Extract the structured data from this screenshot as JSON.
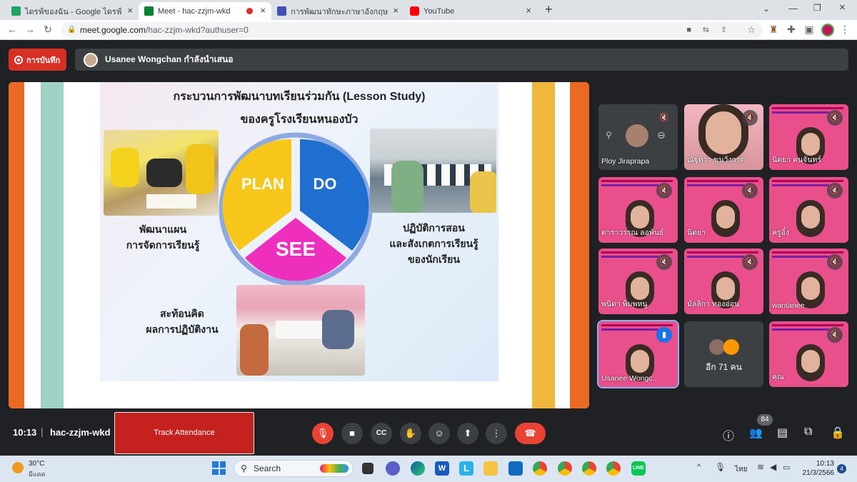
{
  "browser": {
    "tabs": [
      {
        "title": "ไดรฟ์ของฉัน - Google ไดรฟ์",
        "color": "#1fa463"
      },
      {
        "title": "Meet - hac-zzjm-wkd",
        "color": "#00832d",
        "active": true
      },
      {
        "title": "การพัฒนาทักษะภาษาอังกฤษ English",
        "color": "#3f51b5"
      },
      {
        "title": "YouTube",
        "color": "#ff0000"
      }
    ],
    "new_tab": "+",
    "url_host": "meet.google.com",
    "url_path": "/hac-zzjm-wkd?authuser=0"
  },
  "meet": {
    "record_label": "การบันทึก",
    "presenter_text": "Usanee Wongchan กำลังนำเสนอ",
    "slide": {
      "title1": "กระบวนการพัฒนาบทเรียนร่วมกัน (Lesson Study)",
      "title2": "ของครูโรงเรียนหนองบัว",
      "cycle": {
        "plan": "PLAN",
        "do": "DO",
        "see": "SEE"
      },
      "left_caption": [
        "พัฒนาแผน",
        "การจัดการเรียนรู้"
      ],
      "right_caption": [
        "ปฏิบัติการสอน",
        "และสังเกตการเรียนรู้",
        "ของนักเรียน"
      ],
      "bottom_caption": [
        "สะท้อนคิด",
        "ผลการปฏิบัติงาน"
      ]
    },
    "participants": [
      {
        "name": "Ploy Jiraprapa",
        "style": "gray"
      },
      {
        "name": "ณัฐทิวา ขุนวังกรด",
        "style": "face"
      },
      {
        "name": "นิตยา คนจันทร์",
        "style": "slide"
      },
      {
        "name": "ดาราวรรณ ลอพันธ์",
        "style": "slide"
      },
      {
        "name": "นิตยา",
        "style": "slide-face"
      },
      {
        "name": "ครูอิ๋ง",
        "style": "slide"
      },
      {
        "name": "พนิดา พิมพหนู",
        "style": "slide-face"
      },
      {
        "name": "มัลลิกา ทองอ่อน",
        "style": "slide-face"
      },
      {
        "name": "wantanee",
        "style": "slide-face"
      },
      {
        "name": "Usanee Wongc...",
        "style": "slide-face"
      },
      {
        "name": "อีก 71 คน",
        "style": "more"
      },
      {
        "name": "คุณ",
        "style": "slide-face"
      }
    ],
    "time": "10:13",
    "meeting_code": "hac-zzjm-wkd",
    "track_attendance": "Track Attendance",
    "people_count": "84"
  },
  "taskbar": {
    "weather_temp": "30°C",
    "weather_desc": "มีแดด",
    "search_label": "Search",
    "lang": "ไทย",
    "clock_time": "10:13",
    "clock_date": "21/3/2566",
    "notif_count": "4"
  }
}
